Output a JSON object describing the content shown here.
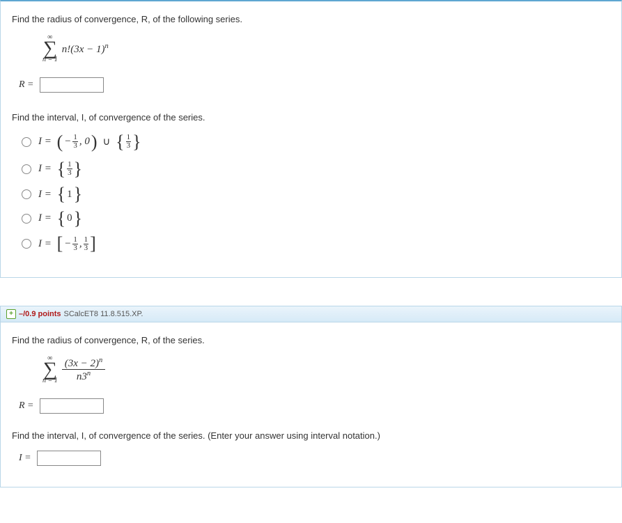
{
  "q1": {
    "prompt1": "Find the radius of convergence, R, of the following series.",
    "sigma_top": "∞",
    "sigma_bot": "n = 1",
    "series_body": "n!(3x − 1)",
    "series_exp": "n",
    "r_label": "R =",
    "prompt2": "Find the interval, I, of convergence of the series.",
    "i_label": "I =",
    "options": {
      "o1_neg": "−",
      "o1_comma_zero": ", 0",
      "o1_union": "∪",
      "o2_val": "",
      "o3_val": "1",
      "o4_val": "0",
      "o5_neg": "−",
      "o5_comma": ", "
    }
  },
  "header": {
    "points": "–/0.9 points",
    "source": "SCalcET8 11.8.515.XP."
  },
  "q2": {
    "prompt1": "Find the radius of convergence, R, of the series.",
    "sigma_top": "∞",
    "sigma_bot": "n = 1",
    "num": "(3x − 2)",
    "num_exp": "n",
    "den_base": "n3",
    "den_exp": "n",
    "r_label": "R =",
    "prompt2": "Find the interval, I, of convergence of the series. (Enter your answer using interval notation.)",
    "i_label": "I ="
  },
  "fracs": {
    "one": "1",
    "three": "3"
  }
}
